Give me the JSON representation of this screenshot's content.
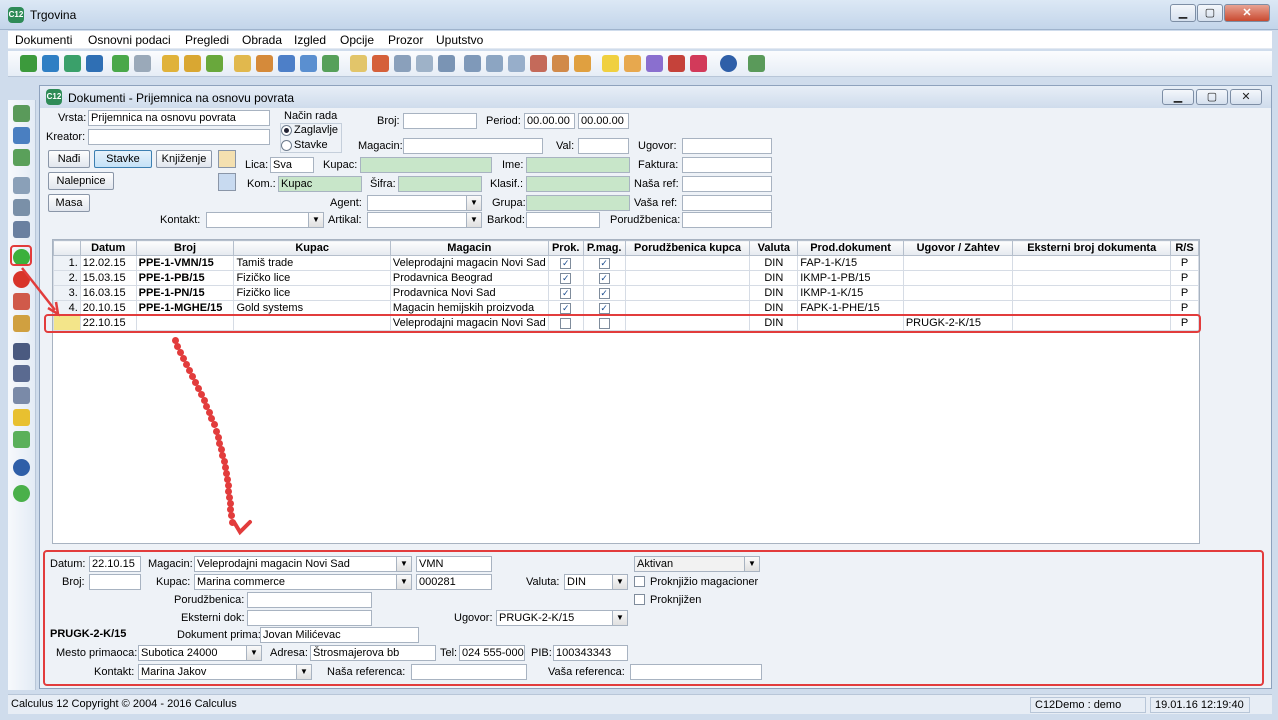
{
  "app": {
    "title": "Trgovina",
    "icon": "C12"
  },
  "menu": [
    "Dokumenti",
    "Osnovni podaci",
    "Pregledi",
    "Obrada",
    "Izgled",
    "Opcije",
    "Prozor",
    "Uputstvo"
  ],
  "window": {
    "title": "Dokumenti - Prijemnica na osnovu povrata",
    "icon": "C12"
  },
  "form": {
    "vrsta_label": "Vrsta:",
    "vrsta_value": "Prijemnica na osnovu povrata",
    "kreator_label": "Kreator:",
    "kreator_value": "",
    "nacin_rada_label": "Način rada",
    "radio_zaglavlje": "Zaglavlje",
    "radio_stavke": "Stavke",
    "broj_label": "Broj:",
    "broj_value": "",
    "period_label": "Period:",
    "period_from": "00.00.00",
    "period_to": "00.00.00",
    "magacin_label": "Magacin:",
    "magacin_value": "",
    "val_label": "Val:",
    "val_value": "",
    "ugovor_label": "Ugovor:",
    "ugovor_value": "",
    "btn_nadji": "Nađi",
    "btn_stavke": "Stavke",
    "btn_knjizenje": "Knjiženje",
    "btn_nalepnice": "Nalepnice",
    "btn_masa": "Masa",
    "lica_label": "Lica:",
    "lica_value": "Sva",
    "kupac_label": "Kupac:",
    "kupac_value": "",
    "ime_label": "Ime:",
    "ime_value": "",
    "faktura_label": "Faktura:",
    "faktura_value": "",
    "kom_label": "Kom.:",
    "kom_value": "Kupac",
    "sifra_label": "Šifra:",
    "sifra_value": "",
    "klasif_label": "Klasif.:",
    "klasif_value": "",
    "nasaref_label": "Naša ref:",
    "nasaref_value": "",
    "agent_label": "Agent:",
    "agent_value": "",
    "grupa_label": "Grupa:",
    "grupa_value": "",
    "vasaref_label": "Vaša ref:",
    "vasaref_value": "",
    "kontakt_label": "Kontakt:",
    "kontakt_value": "",
    "artikal_label": "Artikal:",
    "artikal_value": "",
    "barkod_label": "Barkod:",
    "barkod_value": "",
    "porudzbenica_label": "Porudžbenica:",
    "porudzbenica_value": ""
  },
  "grid": {
    "columns": [
      "",
      "Datum",
      "Broj",
      "Kupac",
      "Magacin",
      "Prok.",
      "P.mag.",
      "Porudžbenica kupca",
      "Valuta",
      "Prod.dokument",
      "Ugovor / Zahtev",
      "Eksterni broj dokumenta",
      "R/S"
    ],
    "rows": [
      {
        "num": "1.",
        "datum": "12.02.15",
        "broj": "PPE-1-VMN/15",
        "kupac": "Tamiš trade",
        "magacin": "Veleprodajni magacin Novi Sad",
        "prok": "✓",
        "pmag": "✓",
        "por": "",
        "valuta": "DIN",
        "prod": "FAP-1-K/15",
        "ugovor": "",
        "eks": "",
        "rs": "P"
      },
      {
        "num": "2.",
        "datum": "15.03.15",
        "broj": "PPE-1-PB/15",
        "kupac": "Fizičko lice",
        "magacin": "Prodavnica Beograd",
        "prok": "✓",
        "pmag": "✓",
        "por": "",
        "valuta": "DIN",
        "prod": "IKMP-1-PB/15",
        "ugovor": "",
        "eks": "",
        "rs": "P"
      },
      {
        "num": "3.",
        "datum": "16.03.15",
        "broj": "PPE-1-PN/15",
        "kupac": "Fizičko lice",
        "magacin": "Prodavnica Novi Sad",
        "prok": "✓",
        "pmag": "✓",
        "por": "",
        "valuta": "DIN",
        "prod": "IKMP-1-K/15",
        "ugovor": "",
        "eks": "",
        "rs": "P"
      },
      {
        "num": "4.",
        "datum": "20.10.15",
        "broj": "PPE-1-MGHE/15",
        "kupac": "Gold systems",
        "magacin": "Magacin hemijskih proizvoda",
        "prok": "✓",
        "pmag": "✓",
        "por": "",
        "valuta": "DIN",
        "prod": "FAPK-1-PHE/15",
        "ugovor": "",
        "eks": "",
        "rs": "P"
      },
      {
        "num": "",
        "datum": "22.10.15",
        "broj": "",
        "kupac": "",
        "magacin": "Veleprodajni magacin Novi Sad",
        "prok": "",
        "pmag": "",
        "por": "",
        "valuta": "DIN",
        "prod": "",
        "ugovor": "PRUGK-2-K/15",
        "eks": "",
        "rs": "P"
      }
    ]
  },
  "detail": {
    "datum_label": "Datum:",
    "datum_value": "22.10.15",
    "magacin_label": "Magacin:",
    "magacin_value": "Veleprodajni magacin Novi Sad",
    "magacin_code": "VMN",
    "status_value": "Aktivan",
    "broj_label": "Broj:",
    "broj_value": "",
    "kupac_label": "Kupac:",
    "kupac_value": "Marina commerce",
    "kupac_code": "000281",
    "valuta_label": "Valuta:",
    "valuta_value": "DIN",
    "proknjizio_label": "Proknjižio magacioner",
    "proknjizen_label": "Proknjižen",
    "porudzbenica_label": "Porudžbenica:",
    "porudzbenica_value": "",
    "eksterni_label": "Eksterni dok:",
    "eksterni_value": "",
    "ugovor_label": "Ugovor:",
    "ugovor_value": "PRUGK-2-K/15",
    "doc_number": "PRUGK-2-K/15",
    "dokprima_label": "Dokument prima:",
    "dokprima_value": "Jovan Milićevac",
    "mesto_label": "Mesto primaoca:",
    "mesto_value": "Subotica  24000",
    "adresa_label": "Adresa:",
    "adresa_value": "Štrosmajerova bb",
    "tel_label": "Tel:",
    "tel_value": "024 555-000",
    "pib_label": "PIB:",
    "pib_value": "100343343",
    "kontakt_label": "Kontakt:",
    "kontakt_value": "Marina Jakov",
    "nasaref_label": "Naša referenca:",
    "nasaref_value": "",
    "vasaref_label": "Vaša referenca:",
    "vasaref_value": ""
  },
  "status": {
    "copyright": "Calculus 12  Copyright © 2004 - 2016  Calculus",
    "user": "C12Demo : demo",
    "datetime": "19.01.16 12:19:40"
  }
}
